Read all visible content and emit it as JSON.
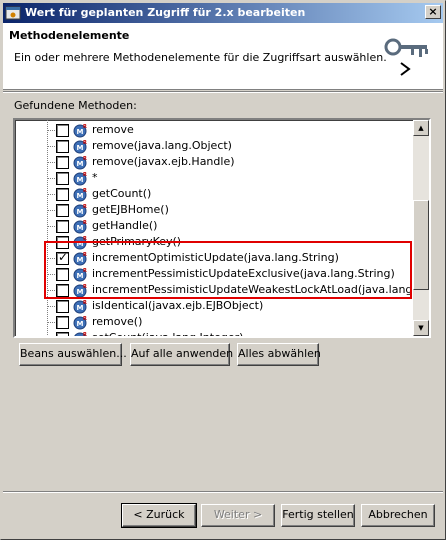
{
  "window": {
    "title": "Wert für geplanten Zugriff für 2.x bearbeiten",
    "close_glyph": "×"
  },
  "header": {
    "title": "Methodenelemente",
    "description": "Ein oder mehrere Methodenelemente für die Zugriffsart auswählen."
  },
  "list": {
    "label": "Gefundene Methoden:",
    "rows": [
      {
        "label": "remove",
        "checked": false
      },
      {
        "label": "remove(java.lang.Object)",
        "checked": false
      },
      {
        "label": "remove(javax.ejb.Handle)",
        "checked": false
      },
      {
        "label": "*",
        "checked": false
      },
      {
        "label": "getCount()",
        "checked": false
      },
      {
        "label": "getEJBHome()",
        "checked": false
      },
      {
        "label": "getHandle()",
        "checked": false
      },
      {
        "label": "getPrimaryKey()",
        "checked": false
      },
      {
        "label": "incrementOptimisticUpdate(java.lang.String)",
        "checked": true
      },
      {
        "label": "incrementPessimisticUpdateExclusive(java.lang.String)",
        "checked": false
      },
      {
        "label": "incrementPessimisticUpdateWeakestLockAtLoad(java.lang.String)",
        "checked": false
      },
      {
        "label": "isIdentical(javax.ejb.EJBObject)",
        "checked": false
      },
      {
        "label": "remove()",
        "checked": false
      },
      {
        "label": "setCount(java.lang.Integer)",
        "checked": false
      }
    ]
  },
  "actions": {
    "select_beans": "Beans auswählen...",
    "apply_all": "Auf alle anwenden",
    "deselect_all": "Alles abwählen"
  },
  "footer": {
    "back": "< Zurück",
    "next": "Weiter >",
    "finish": "Fertig stellen",
    "cancel": "Abbrechen"
  },
  "colors": {
    "highlight": "#e00000",
    "title_start": "#0a246a",
    "title_end": "#a6caf0"
  },
  "icons": {
    "header": "key-icon",
    "method": "method-bean-icon"
  }
}
